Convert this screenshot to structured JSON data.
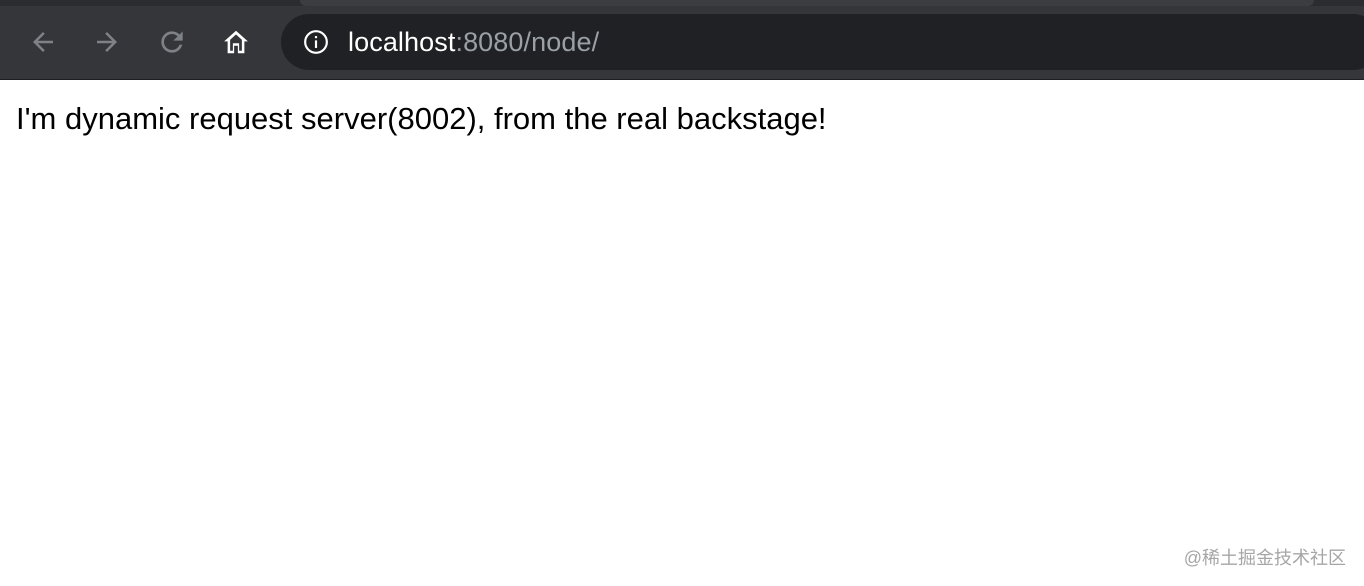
{
  "browser": {
    "nav": {
      "back_icon": "arrow-left-icon",
      "forward_icon": "arrow-right-icon",
      "reload_icon": "reload-icon",
      "home_icon": "home-icon"
    },
    "address_bar": {
      "info_icon": "info-icon",
      "host": "localhost",
      "rest": ":8080/node/"
    },
    "colors": {
      "toolbar": "#35363a",
      "omnibox": "#202124",
      "url_host": "#ffffff",
      "url_rest": "#9aa0a6"
    }
  },
  "page": {
    "body_text": "I'm dynamic request server(8002), from the real backstage!"
  },
  "watermark": {
    "text": "@稀土掘金技术社区"
  }
}
